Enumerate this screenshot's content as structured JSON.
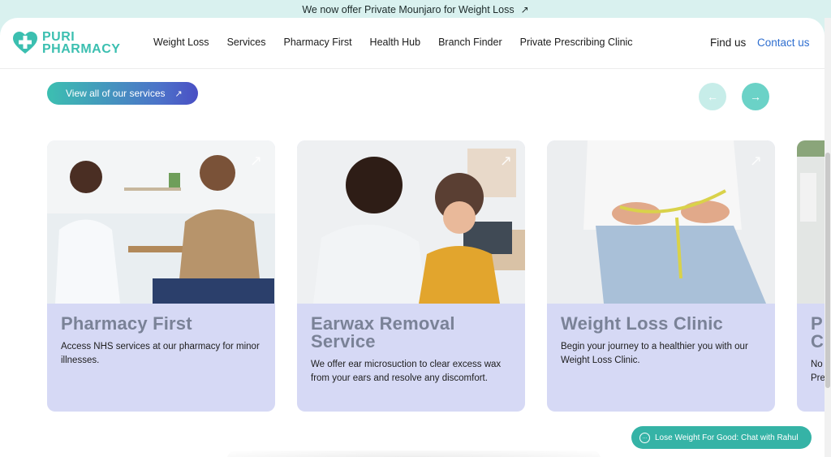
{
  "announcement": {
    "text": "We now offer Private Mounjaro for Weight Loss",
    "arrow": "↗"
  },
  "brand": {
    "line1": "PURI",
    "line2": "PHARMACY",
    "color": "#3bbfb0"
  },
  "nav": {
    "items": [
      {
        "label": "Weight Loss"
      },
      {
        "label": "Services"
      },
      {
        "label": "Pharmacy First"
      },
      {
        "label": "Health Hub"
      },
      {
        "label": "Branch Finder"
      },
      {
        "label": "Private Prescribing Clinic"
      }
    ],
    "find_us": "Find us",
    "contact_us": "Contact us"
  },
  "services": {
    "view_all_label": "View all of our services",
    "view_all_arrow": "↗",
    "prev_icon": "←",
    "next_icon": "→",
    "cards": [
      {
        "title": "Pharmacy First",
        "description": "Access NHS services at our pharmacy for minor illnesses."
      },
      {
        "title": "Earwax Removal Service",
        "description": "We offer ear microsuction to clear excess wax from your ears and resolve any discomfort."
      },
      {
        "title": "Weight Loss Clinic",
        "description": "Begin your journey to a healthier you with our Weight Loss Clinic."
      },
      {
        "title": "P C",
        "description": "No Pre"
      }
    ]
  },
  "chat": {
    "label": "Lose Weight For Good: Chat with Rahul"
  },
  "colors": {
    "accent": "#3cbfb1",
    "card_bg": "#d6d9f5",
    "link": "#2f6fd0"
  }
}
